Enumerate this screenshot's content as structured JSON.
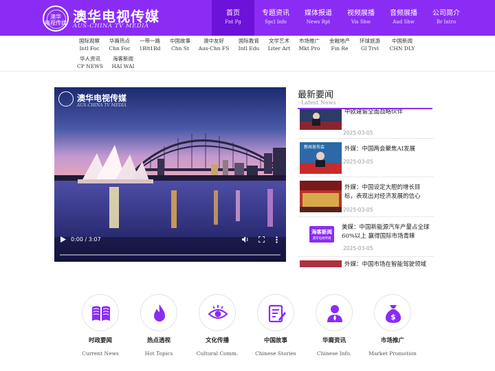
{
  "header": {
    "logo_cn": "澳华电视传媒",
    "logo_en": "AUS-CHINA TV MEDIA",
    "logo_badge": "澳华\n电视传媒",
    "nav": [
      {
        "cn": "首页",
        "en": "Fnt Pg",
        "active": true
      },
      {
        "cn": "专题资讯",
        "en": "Spcl Info"
      },
      {
        "cn": "媒体报道",
        "en": "News Rpt"
      },
      {
        "cn": "视频展播",
        "en": "Vis Shw"
      },
      {
        "cn": "音频展播",
        "en": "Aud Shw"
      },
      {
        "cn": "公司简介",
        "en": "Br Intro"
      }
    ]
  },
  "subnav": [
    {
      "cn": "国际观察",
      "en": "Intl Foc"
    },
    {
      "cn": "华裔热点",
      "en": "Chn Foc"
    },
    {
      "cn": "一带一路",
      "en": "1Blt1Rd"
    },
    {
      "cn": "中国故事",
      "en": "Chn St"
    },
    {
      "cn": "澳中友好",
      "en": "Aus-Chn FS"
    },
    {
      "cn": "国际教育",
      "en": "Intl Edu"
    },
    {
      "cn": "文学艺术",
      "en": "Liter Art"
    },
    {
      "cn": "市场推广",
      "en": "Mkt Pro"
    },
    {
      "cn": "金融地产",
      "en": "Fin Re"
    },
    {
      "cn": "环球旅游",
      "en": "Gl Trvl"
    },
    {
      "cn": "中国新闻",
      "en": "CHN DLY"
    },
    {
      "cn": "华人资讯",
      "en": "CP NEWS"
    },
    {
      "cn": "海客新闻",
      "en": "HAI WAI"
    }
  ],
  "video": {
    "overlay_cn": "澳华电视传媒",
    "overlay_en": "AUS-CHINA TV MEDIA",
    "time": "0:00 / 3:07",
    "progress": 0
  },
  "news": {
    "title": "最新要闻",
    "subtitle": "Latest News",
    "items": [
      {
        "text": "中欧建留全面战略伙伴",
        "date": "2025-03-05"
      },
      {
        "text": "外媒：中国两会聚焦AI发展",
        "date": "2025-03-05"
      },
      {
        "text": "外媒：中国设定大胆的增长目标，表现出对经济发展的信心",
        "date": "2025-03-05"
      },
      {
        "text": "美媒：中国新能源汽车产量占全球60%以上 赢得国际市场青睐",
        "date": "2025-03-05",
        "badge": "海客新闻",
        "badge_sub": "澳华电视传媒"
      },
      {
        "text": "外媒：中国市场在智能驾驶领域",
        "date": ""
      }
    ]
  },
  "features": [
    {
      "cn": "时政要闻",
      "en": "Current News",
      "icon": "book-icon"
    },
    {
      "cn": "热点透视",
      "en": "Hot Topics",
      "icon": "flame-icon"
    },
    {
      "cn": "文化传播",
      "en": "Cultural Comm.",
      "icon": "eye-icon"
    },
    {
      "cn": "中国故事",
      "en": "Chinese Stories",
      "icon": "notepad-icon"
    },
    {
      "cn": "华裔资讯",
      "en": "Chinese Info.",
      "icon": "user-icon"
    },
    {
      "cn": "市场推广",
      "en": "Market Promotion",
      "icon": "money-bag-icon"
    }
  ],
  "colors": {
    "brand": "#8b2cf5",
    "brand_dark": "#6d12d8"
  }
}
